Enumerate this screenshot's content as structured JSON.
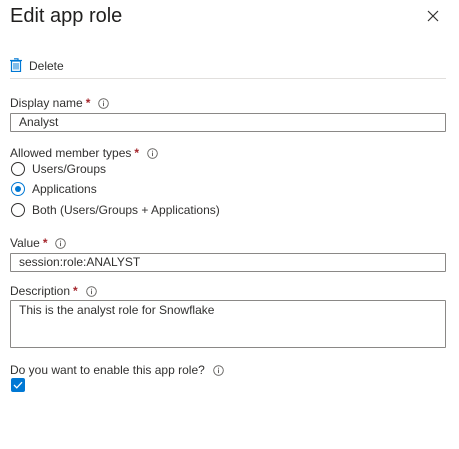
{
  "header": {
    "title": "Edit app role",
    "close_icon": "close-icon"
  },
  "toolbar": {
    "delete_label": "Delete",
    "delete_icon": "trash-icon"
  },
  "form": {
    "display_name": {
      "label": "Display name",
      "required_mark": "*",
      "value": "Analyst"
    },
    "member_types": {
      "label": "Allowed member types",
      "required_mark": "*",
      "options": [
        {
          "label": "Users/Groups",
          "selected": false
        },
        {
          "label": "Applications",
          "selected": true
        },
        {
          "label": "Both (Users/Groups + Applications)",
          "selected": false
        }
      ]
    },
    "value": {
      "label": "Value",
      "required_mark": "*",
      "value": "session:role:ANALYST"
    },
    "description": {
      "label": "Description",
      "required_mark": "*",
      "value": "This is the analyst role for Snowflake"
    },
    "enable": {
      "label": "Do you want to enable this app role?",
      "checked": true
    }
  },
  "colors": {
    "accent": "#0078d4",
    "required": "#a4262c",
    "border": "#8a8886",
    "divider": "#e1dfdd"
  }
}
